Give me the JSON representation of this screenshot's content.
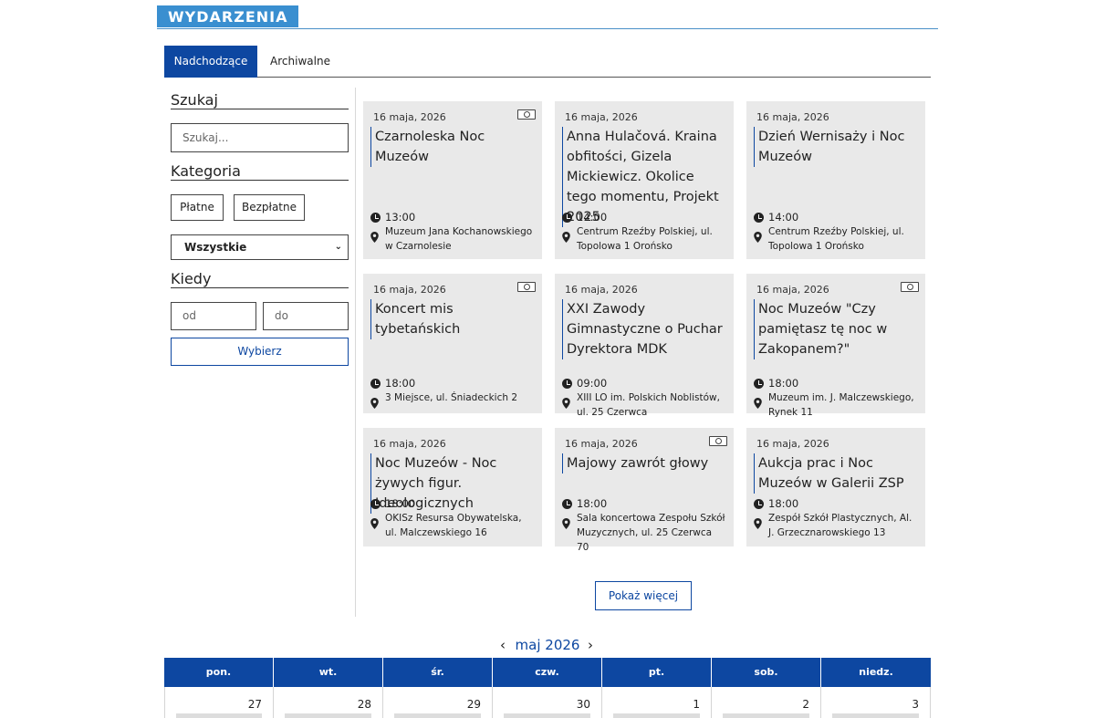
{
  "section": {
    "title": "WYDARZENIA"
  },
  "tabs": {
    "upcoming": "Nadchodzące",
    "archive": "Archiwalne"
  },
  "sidebar": {
    "search_heading": "Szukaj",
    "search_placeholder": "Szukaj...",
    "category_heading": "Kategoria",
    "paid_label": "Płatne",
    "free_label": "Bezpłatne",
    "category_select_value": "Wszystkie",
    "when_heading": "Kiedy",
    "from_placeholder": "od",
    "to_placeholder": "do",
    "choose_label": "Wybierz"
  },
  "events": [
    {
      "date": "16 maja, 2026",
      "title": "Czarnoleska Noc Muzeów",
      "time": "13:00",
      "location": "Muzeum Jana Kochanowskiego w Czarnolesie",
      "paid": true
    },
    {
      "date": "16 maja, 2026",
      "title": "Anna Hulačová. Kraina obfitości, Gizela Mickiewicz. Okolice tego momentu, Projekt 2025",
      "time": "14:00",
      "location": "Centrum Rzeźby Polskiej, ul. Topolowa 1 Orońsko",
      "paid": false
    },
    {
      "date": "16 maja, 2026",
      "title": "Dzień Wernisaży i Noc Muzeów",
      "time": "14:00",
      "location": "Centrum Rzeźby Polskiej, ul. Topolowa 1 Orońsko",
      "paid": false
    },
    {
      "date": "16 maja, 2026",
      "title": "Koncert mis tybetańskich",
      "time": "18:00",
      "location": "3 Miejsce, ul. Śniadeckich 2",
      "paid": true
    },
    {
      "date": "16 maja, 2026",
      "title": "XXI Zawody Gimnastyczne o Puchar Dyrektora MDK",
      "time": "09:00",
      "location": "XIII LO im. Polskich Noblistów, ul. 25 Czerwca",
      "paid": false
    },
    {
      "date": "16 maja, 2026",
      "title": "Noc Muzeów \"Czy pamiętasz tę noc w Zakopanem?\"",
      "time": "18:00",
      "location": "Muzeum im. J. Malczewskiego, Rynek 11",
      "paid": true
    },
    {
      "date": "16 maja, 2026",
      "title": "Noc Muzeów - Noc żywych figur. Ideologicznych",
      "time": "18:00",
      "location": "OKISz Resursa Obywatelska, ul. Malczewskiego 16",
      "paid": false
    },
    {
      "date": "16 maja, 2026",
      "title": "Majowy zawrót głowy",
      "time": "18:00",
      "location": "Sala koncertowa Zespołu Szkół Muzycznych, ul. 25 Czerwca 70",
      "paid": true
    },
    {
      "date": "16 maja, 2026",
      "title": "Aukcja prac i Noc Muzeów w Galerii ZSP",
      "time": "18:00",
      "location": "Zespół Szkół Plastycznych, Al. J. Grzecznarowskiego 13",
      "paid": false
    }
  ],
  "more_label": "Pokaż więcej",
  "calendar": {
    "month_label": "maj 2026",
    "prev": "‹",
    "next": "›",
    "weekdays": [
      "pon.",
      "wt.",
      "śr.",
      "czw.",
      "pt.",
      "sob.",
      "niedz."
    ],
    "first_row": [
      "27",
      "28",
      "29",
      "30",
      "1",
      "2",
      "3"
    ]
  }
}
